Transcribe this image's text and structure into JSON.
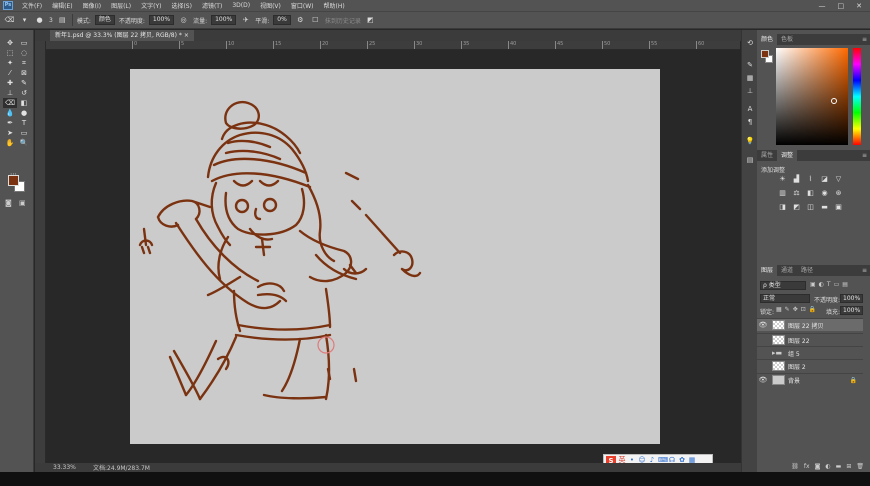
{
  "app": {
    "logo": "Ps"
  },
  "menu": [
    "文件(F)",
    "编辑(E)",
    "图像(I)",
    "图层(L)",
    "文字(Y)",
    "选择(S)",
    "滤镜(T)",
    "3D(D)",
    "视图(V)",
    "窗口(W)",
    "帮助(H)"
  ],
  "window_controls": {
    "minimize": "—",
    "maximize": "□",
    "close": "✕"
  },
  "options": {
    "brush_size": "3",
    "mode_label": "模式:",
    "mode_value": "颜色",
    "opacity_label": "不透明度:",
    "opacity_value": "100%",
    "flow_label": "流量:",
    "flow_value": "100%",
    "smooth_label": "平滑:",
    "smooth_value": "0%",
    "erase_history_label": "抹到历史记录"
  },
  "document": {
    "tab_title": "新年1.psd @ 33.3% (图层 22 拷贝, RGB/8) *",
    "close": "×"
  },
  "ruler_marks": [
    "0",
    "5",
    "10",
    "15",
    "20",
    "25",
    "30",
    "35",
    "40",
    "45",
    "50",
    "55",
    "60",
    "65",
    "70"
  ],
  "status": {
    "zoom": "33.33%",
    "doc_info": "文档:24.9M/283.7M"
  },
  "panels": {
    "color_tabs": [
      "颜色",
      "色板"
    ],
    "adjust_tabs": [
      "属性",
      "调整"
    ],
    "adjust_title": "添加调整",
    "layers_tabs": [
      "图层",
      "通道",
      "路径"
    ]
  },
  "layers_panel": {
    "filter_label": "ρ 类型",
    "blend_mode": "正常",
    "opacity_label": "不透明度:",
    "opacity_value": "100%",
    "lock_label": "锁定:",
    "fill_label": "填充:",
    "fill_value": "100%",
    "layers": [
      {
        "name": "图层 22 拷贝",
        "visible": true,
        "selected": true,
        "kind": "layer"
      },
      {
        "name": "图层 22",
        "visible": false,
        "selected": false,
        "kind": "layer"
      },
      {
        "name": "组 5",
        "visible": false,
        "selected": false,
        "kind": "group"
      },
      {
        "name": "图层 2",
        "visible": false,
        "selected": false,
        "kind": "layer"
      },
      {
        "name": "背景",
        "visible": true,
        "selected": false,
        "kind": "background"
      }
    ]
  },
  "ime": {
    "logo": "S",
    "mode": "英"
  },
  "colors": {
    "foreground": "#7a3210",
    "background": "#ffffff",
    "sketch_stroke": "#7a3210"
  }
}
